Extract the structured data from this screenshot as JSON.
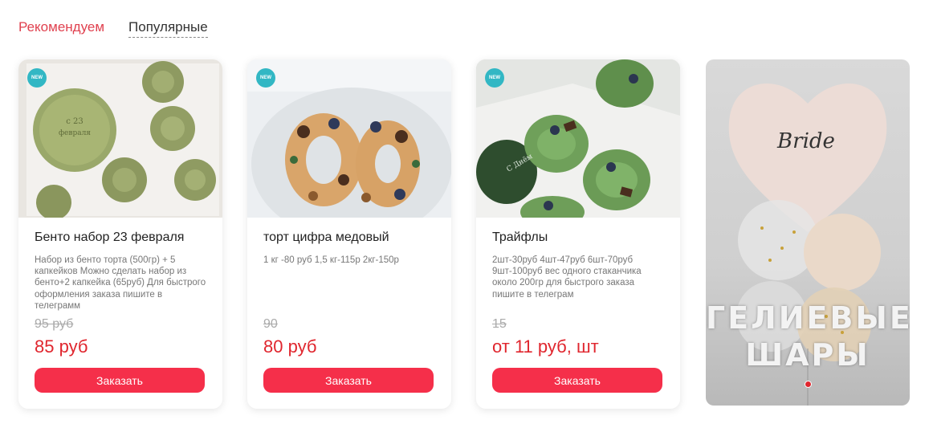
{
  "tabs": [
    {
      "label": "Рекомендуем",
      "active": true
    },
    {
      "label": "Популярные",
      "active": false
    }
  ],
  "badge_label": "NEW",
  "products": [
    {
      "title": "Бенто набор 23 февраля",
      "description": "Набор из бенто торта (500гр) + 5 капкейков Можно сделать набор из бенто+2 капкейка (65руб) Для быстрого оформления заказа пишите в телеграмм",
      "old_price": "95 руб",
      "price": "85 руб",
      "button": "Заказать",
      "badge": true
    },
    {
      "title": "торт цифра медовый",
      "description": "1 кг -80 руб 1,5 кг-115р 2кг-150р",
      "old_price": "90",
      "price": "80 руб",
      "button": "Заказать",
      "badge": true
    },
    {
      "title": "Трайфлы",
      "description": "2шт-30руб 4шт-47руб 6шт-70руб 9шт-100руб вес одного стаканчика около 200гр для быстрого заказа пишите в телеграм",
      "old_price": "15",
      "price": "от 11 руб, шт",
      "button": "Заказать",
      "badge": true
    }
  ],
  "promo": {
    "line1": "ГЕЛИЕВЫЕ",
    "line2": "ШАРЫ",
    "balloon_script": "Bride"
  },
  "colors": {
    "accent": "#f52f4a",
    "price": "#e0262e",
    "badge": "#32b7c4",
    "tab_active": "#e0414f"
  }
}
